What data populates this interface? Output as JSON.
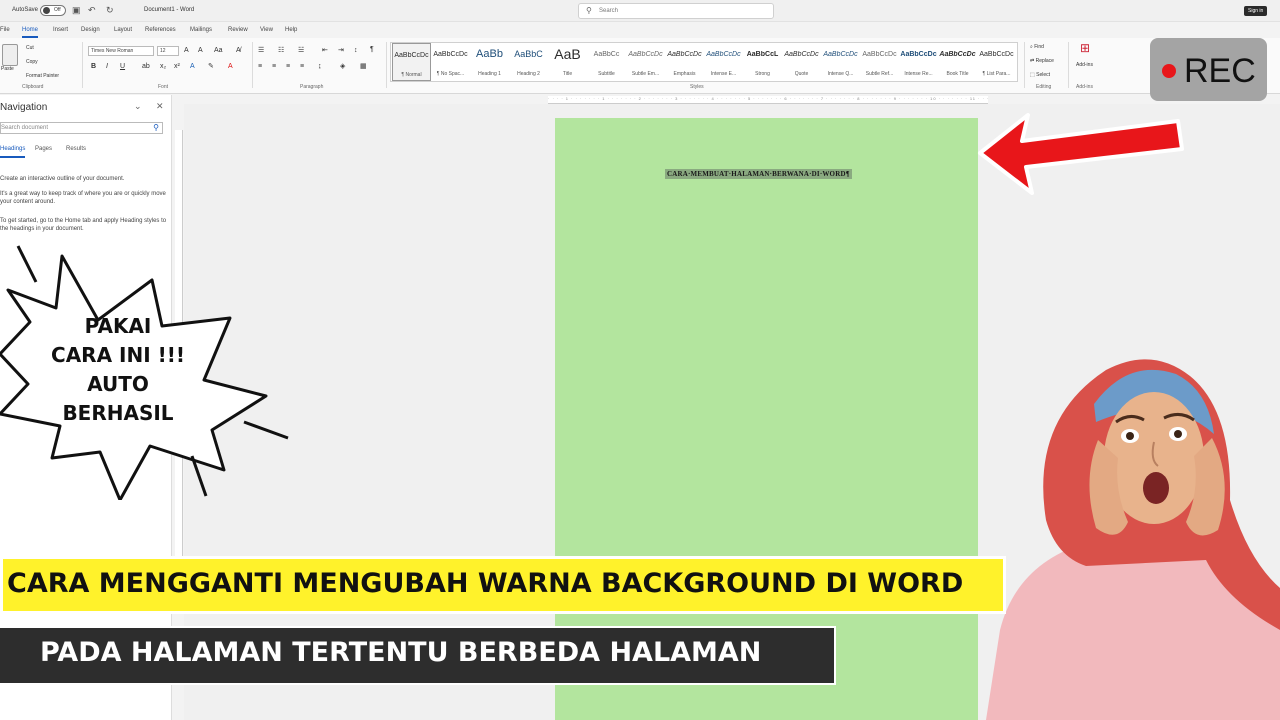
{
  "titlebar": {
    "autosave_label": "AutoSave",
    "autosave_state": "Off",
    "doc_title": "Document1 - Word",
    "search_placeholder": "Search",
    "signin_label": "Sign in"
  },
  "menu": {
    "tabs": [
      "File",
      "Home",
      "Insert",
      "Design",
      "Layout",
      "References",
      "Mailings",
      "Review",
      "View",
      "Help"
    ],
    "active": "Home"
  },
  "ribbon": {
    "clipboard": {
      "paste": "Paste",
      "cut": "Cut",
      "copy": "Copy",
      "format_painter": "Format Painter",
      "group_label": "Clipboard"
    },
    "font": {
      "family": "Times New Roman",
      "size": "12",
      "group_label": "Font"
    },
    "paragraph": {
      "group_label": "Paragraph"
    },
    "styles": {
      "group_label": "Styles",
      "items": [
        {
          "preview": "AaBbCcDc",
          "name": "¶ Normal"
        },
        {
          "preview": "AaBbCcDc",
          "name": "¶ No Spac..."
        },
        {
          "preview": "AaBb",
          "name": "Heading 1"
        },
        {
          "preview": "AaBbC",
          "name": "Heading 2"
        },
        {
          "preview": "AaB",
          "name": "Title"
        },
        {
          "preview": "AaBbCc",
          "name": "Subtitle"
        },
        {
          "preview": "AaBbCcDc",
          "name": "Subtle Em..."
        },
        {
          "preview": "AaBbCcDc",
          "name": "Emphasis"
        },
        {
          "preview": "AaBbCcDc",
          "name": "Intense E..."
        },
        {
          "preview": "AaBbCcL",
          "name": "Strong"
        },
        {
          "preview": "AaBbCcDc",
          "name": "Quote"
        },
        {
          "preview": "AaBbCcDc",
          "name": "Intense Q..."
        },
        {
          "preview": "AaBbCcDc",
          "name": "Subtle Ref..."
        },
        {
          "preview": "AaBbCcDc",
          "name": "Intense Re..."
        },
        {
          "preview": "AaBbCcDc",
          "name": "Book Title"
        },
        {
          "preview": "AaBbCcDc",
          "name": "¶ List Para..."
        }
      ]
    },
    "editing": {
      "find": "Find",
      "replace": "Replace",
      "select": "Select",
      "group_label": "Editing"
    },
    "addins": {
      "label": "Add-ins",
      "group_label": "Add-ins"
    }
  },
  "navigation": {
    "title": "Navigation",
    "search_placeholder": "Search document",
    "tabs": [
      "Headings",
      "Pages",
      "Results"
    ],
    "active_tab": "Headings",
    "paragraphs": [
      "Create an interactive outline of your document.",
      "It's a great way to keep track of where you are or quickly move your content around.",
      "To get started, go to the Home tab and apply Heading styles to the headings in your document."
    ]
  },
  "document": {
    "page_color": "#b3e59e",
    "title_text": "CARA·MEMBUAT·HALAMAN·BERWANA·DI·WORD¶"
  },
  "overlays": {
    "rec_label": "REC",
    "burst_lines": [
      "PAKAI",
      "CARA INI !!!",
      "AUTO",
      "BERHASIL"
    ],
    "banner_top": "CARA MENGGANTI MENGUBAH WARNA BACKGROUND DI WORD",
    "banner_bottom": "PADA HALAMAN TERTENTU BERBEDA HALAMAN",
    "colors": {
      "banner_top_bg": "#fff22b",
      "banner_bottom_bg": "#2d2d2d",
      "arrow": "#e8161a",
      "rec_dot": "#e8161a"
    }
  }
}
